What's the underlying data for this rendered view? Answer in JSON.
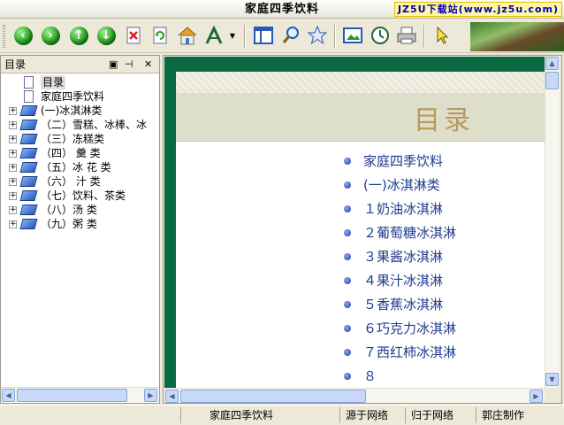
{
  "window": {
    "title": "家庭四季饮料",
    "watermark": "JZ5U下载站(www.jz5u.com)"
  },
  "toolbar": {
    "buttons": [
      "back-icon",
      "forward-icon",
      "up-icon",
      "down-icon",
      "delete-icon",
      "refresh-icon",
      "home-icon",
      "font-icon",
      "panel-icon",
      "search-icon",
      "favorites-icon",
      "picture-icon",
      "clock-icon",
      "print-icon",
      "pointer-icon"
    ]
  },
  "left_panel": {
    "title": "目录",
    "tree": [
      {
        "label": "目录",
        "type": "doc",
        "selected": true
      },
      {
        "label": "家庭四季饮料",
        "type": "doc"
      },
      {
        "label": "(一)冰淇淋类",
        "type": "book"
      },
      {
        "label": "（二）雪糕、冰棒、冰",
        "type": "book"
      },
      {
        "label": "（三）冻糕类",
        "type": "book"
      },
      {
        "label": "（四）  羹      类",
        "type": "book"
      },
      {
        "label": "（五）冰    花    类",
        "type": "book"
      },
      {
        "label": "（六）   汁        类",
        "type": "book"
      },
      {
        "label": "（七）饮料、茶类",
        "type": "book"
      },
      {
        "label": "（八）汤        类",
        "type": "book"
      },
      {
        "label": "（九）粥        类",
        "type": "book"
      }
    ]
  },
  "content": {
    "page_title": "目录",
    "toc": [
      "家庭四季饮料",
      "(一)冰淇淋类",
      "１奶油冰淇淋",
      "２葡萄糖冰淇淋",
      "３果酱冰淇淋",
      "４果汁冰淇淋",
      "５香蕉冰淇淋",
      "６巧克力冰淇淋",
      "７西红柿冰淇淋",
      "８"
    ]
  },
  "status": {
    "book": "家庭四季饮料",
    "source": "源于网络",
    "return": "归于网络",
    "maker": "郭庄制作"
  }
}
